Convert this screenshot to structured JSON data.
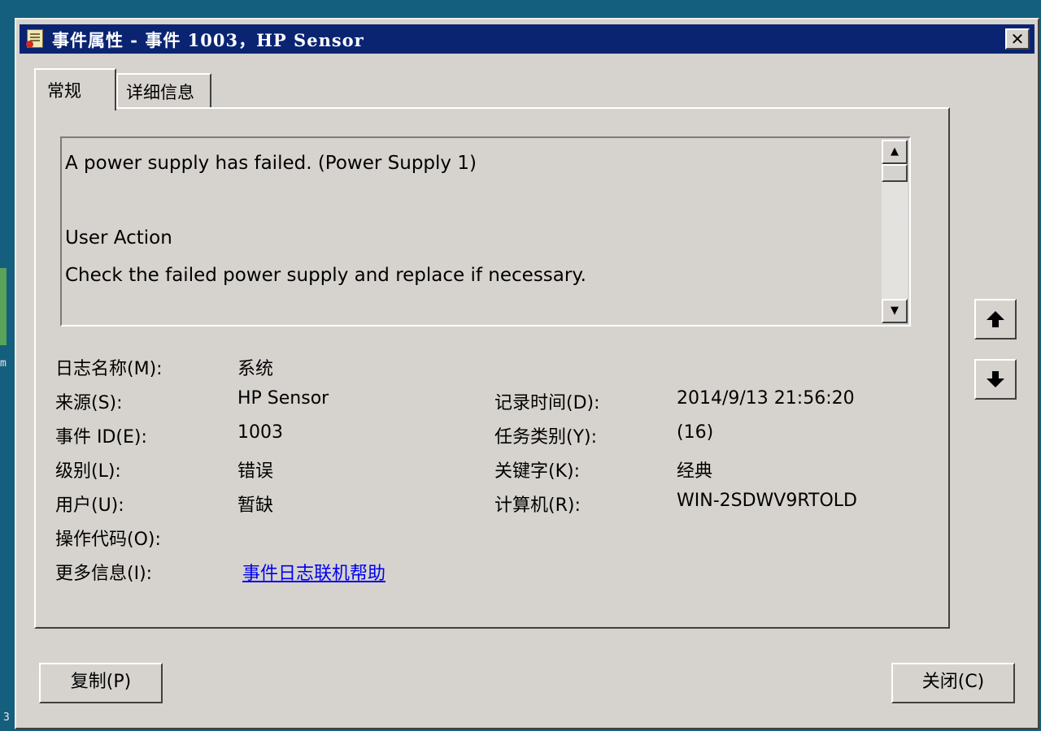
{
  "desktop": {
    "marks": [
      "m",
      "3"
    ]
  },
  "window": {
    "title": "事件属性 - 事件 1003，HP Sensor",
    "close_glyph": "✕"
  },
  "tabs": [
    {
      "label": "常规",
      "active": true
    },
    {
      "label": "详细信息",
      "active": false
    }
  ],
  "description": {
    "lines": [
      "A power supply has failed. (Power Supply 1)",
      "",
      "User Action",
      "Check the failed power supply and replace if necessary."
    ]
  },
  "properties": {
    "log_name": {
      "label": "日志名称(M):",
      "value": "系统"
    },
    "source": {
      "label": "来源(S):",
      "value": "HP Sensor"
    },
    "logged": {
      "label": "记录时间(D):",
      "value": "2014/9/13 21:56:20"
    },
    "event_id": {
      "label": "事件 ID(E):",
      "value": "1003"
    },
    "task_category": {
      "label": "任务类别(Y):",
      "value": "(16)"
    },
    "level": {
      "label": "级别(L):",
      "value": "错误"
    },
    "keywords": {
      "label": "关键字(K):",
      "value": "经典"
    },
    "user": {
      "label": "用户(U):",
      "value": "暂缺"
    },
    "computer": {
      "label": "计算机(R):",
      "value": "WIN-2SDWV9RTOLD"
    },
    "opcode": {
      "label": "操作代码(O):",
      "value": ""
    },
    "more_info": {
      "label": "更多信息(I):",
      "link": "事件日志联机帮助"
    }
  },
  "buttons": {
    "copy": "复制(P)",
    "close": "关闭(C)"
  }
}
